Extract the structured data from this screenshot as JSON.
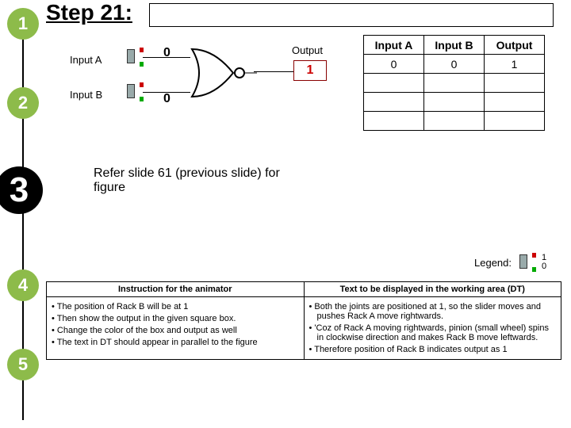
{
  "nav": {
    "p1": "1",
    "p2": "2",
    "p3": "3",
    "p4": "4",
    "p5": "5"
  },
  "step_title": "Step 21:",
  "circuit": {
    "input_a_label": "Input A",
    "input_b_label": "Input B",
    "value_a": "0",
    "value_b": "0",
    "output_label": "Output",
    "output_value": "1"
  },
  "truth": {
    "headers": {
      "a": "Input A",
      "b": "Input B",
      "out": "Output"
    },
    "rows": [
      {
        "a": "0",
        "b": "0",
        "out": "1"
      },
      {
        "a": "",
        "b": "",
        "out": ""
      },
      {
        "a": "",
        "b": "",
        "out": ""
      },
      {
        "a": "",
        "b": "",
        "out": ""
      }
    ]
  },
  "refer_text": "Refer slide 61 (previous slide) for figure",
  "legend": {
    "label": "Legend:",
    "one": "1",
    "zero": "0"
  },
  "lower": {
    "col1_header": "Instruction for the animator",
    "col2_header": "Text to be displayed in the working area (DT)",
    "col1_items": [
      "The position of Rack B will be at 1",
      "Then show the output in the given square box.",
      "Change the color of the box and output as well",
      "The text in DT should appear  in parallel to the figure"
    ],
    "col2_items": [
      "Both the joints are positioned at 1, so the slider moves and pushes Rack A move rightwards.",
      "'Coz of  Rack A moving rightwards, pinion (small wheel) spins in clockwise direction and makes Rack B move leftwards.",
      "Therefore position of Rack B indicates output as 1"
    ]
  },
  "chart_data": {
    "type": "table",
    "title": "NOR gate truth table (partial, step 21)",
    "columns": [
      "Input A",
      "Input B",
      "Output"
    ],
    "rows": [
      [
        0,
        0,
        1
      ]
    ]
  }
}
